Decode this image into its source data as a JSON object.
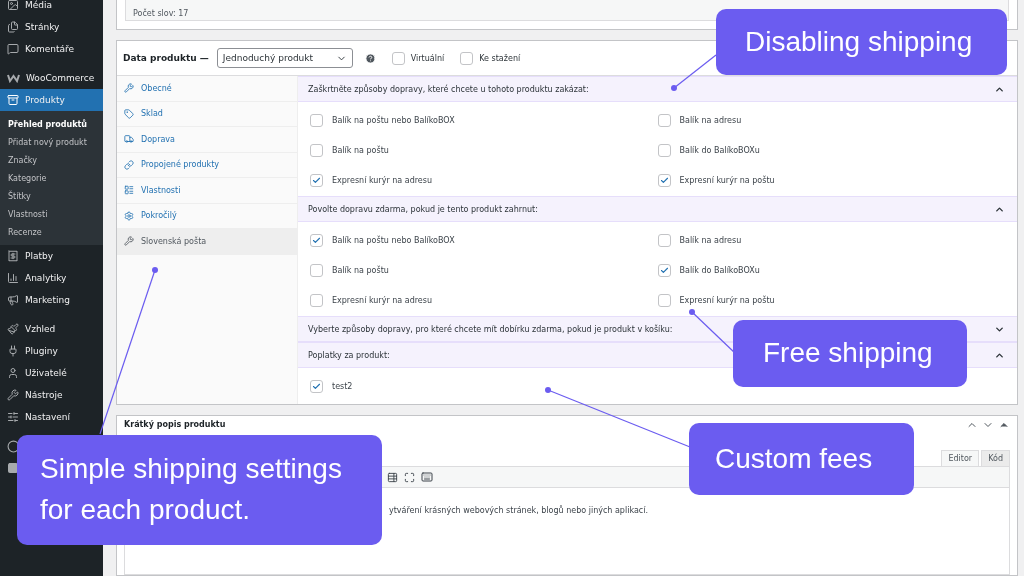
{
  "sidebar": {
    "items": [
      {
        "label": "Média",
        "selected": false
      },
      {
        "label": "Stránky",
        "selected": false
      },
      {
        "label": "Komentáře",
        "selected": false
      },
      {
        "label": "WooCommerce",
        "selected": false
      },
      {
        "label": "Produkty",
        "selected": true,
        "children": [
          {
            "label": "Přehled produktů",
            "selected": true
          },
          {
            "label": "Přidat nový produkt",
            "selected": false
          },
          {
            "label": "Značky",
            "selected": false
          },
          {
            "label": "Kategorie",
            "selected": false
          },
          {
            "label": "Štítky",
            "selected": false
          },
          {
            "label": "Vlastnosti",
            "selected": false
          },
          {
            "label": "Recenze",
            "selected": false
          }
        ]
      },
      {
        "label": "Platby",
        "selected": false
      },
      {
        "label": "Analytiky",
        "selected": false
      },
      {
        "label": "Marketing",
        "selected": false
      },
      {
        "label": "Vzhled",
        "selected": false
      },
      {
        "label": "Pluginy",
        "selected": false
      },
      {
        "label": "Uživatelé",
        "selected": false
      },
      {
        "label": "Nástroje",
        "selected": false
      },
      {
        "label": "Nastavení",
        "selected": false
      }
    ]
  },
  "word_count": "Počet slov: 17",
  "product_data": {
    "title": "Data produktu —",
    "product_type": "Jednoduchý produkt",
    "options": [
      {
        "label": "Virtuální",
        "checked": false
      },
      {
        "label": "Ke stažení",
        "checked": false
      }
    ],
    "tabs": [
      {
        "label": "Obecné",
        "selected": false
      },
      {
        "label": "Sklad",
        "selected": false
      },
      {
        "label": "Doprava",
        "selected": false
      },
      {
        "label": "Propojené produkty",
        "selected": false
      },
      {
        "label": "Vlastnosti",
        "selected": false
      },
      {
        "label": "Pokročilý",
        "selected": false
      },
      {
        "label": "Slovenská pošta",
        "selected": true
      }
    ],
    "sections": [
      {
        "title": "Zaškrtněte způsoby dopravy, které chcete u tohoto produktu zakázat:",
        "expanded": true,
        "options": [
          {
            "label": "Balík na poštu nebo BalíkoBOX",
            "checked": false
          },
          {
            "label": "Balík na adresu",
            "checked": false
          },
          {
            "label": "Balík na poštu",
            "checked": false
          },
          {
            "label": "Balík do BalíkoBOXu",
            "checked": false
          },
          {
            "label": "Expresní kurýr na adresu",
            "checked": true
          },
          {
            "label": "Expresní kurýr na poštu",
            "checked": true
          }
        ]
      },
      {
        "title": "Povolte dopravu zdarma, pokud je tento produkt zahrnut:",
        "expanded": true,
        "options": [
          {
            "label": "Balík na poštu nebo BalíkoBOX",
            "checked": true
          },
          {
            "label": "Balík na adresu",
            "checked": false
          },
          {
            "label": "Balík na poštu",
            "checked": false
          },
          {
            "label": "Balík do BalíkoBOXu",
            "checked": true
          },
          {
            "label": "Expresní kurýr na adresu",
            "checked": false
          },
          {
            "label": "Expresní kurýr na poštu",
            "checked": false
          }
        ]
      },
      {
        "title": "Vyberte způsoby dopravy, pro které chcete mít dobírku zdarma, pokud je produkt v košíku:",
        "expanded": false
      },
      {
        "title": "Poplatky za produkt:",
        "expanded": true,
        "options": [
          {
            "label": "test2",
            "checked": true
          }
        ]
      }
    ]
  },
  "short_description": {
    "title": "Krátký popis produktu",
    "tabs": [
      {
        "label": "Editor",
        "selected": true
      },
      {
        "label": "Kód",
        "selected": false
      }
    ],
    "content": "ytváření krásných webových stránek, blogů nebo jiných aplikací."
  },
  "callouts": [
    {
      "text": "Disabling shipping"
    },
    {
      "text": "Free shipping"
    },
    {
      "text": "Custom fees"
    },
    {
      "text": "Simple shipping settings for each product."
    }
  ]
}
